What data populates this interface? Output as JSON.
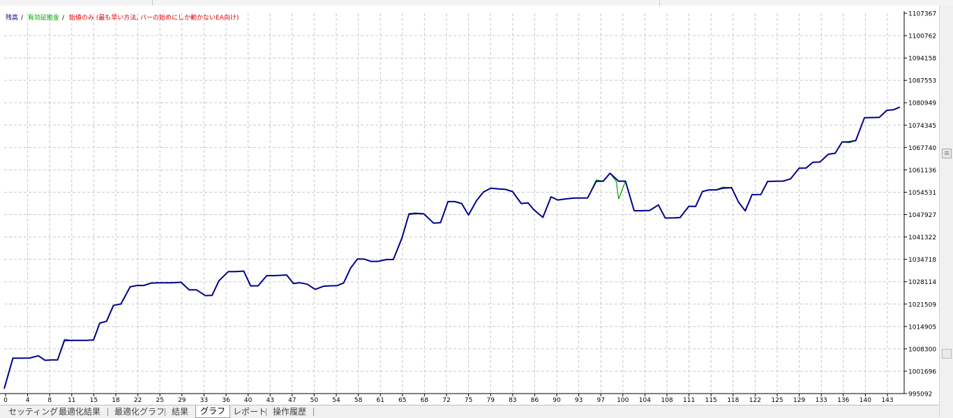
{
  "colors": {
    "balance": "#00008b",
    "equity": "#00a000",
    "note": "#e00000",
    "grid": "#c8c8c8",
    "axis": "#808080"
  },
  "legend": {
    "balance_label": "残高",
    "separator": "/",
    "equity_label": "有効証拠金",
    "note": "始値のみ (最も早い方法, バーの始めにしか動かないEA向け)"
  },
  "tabs": [
    {
      "label": "セッティング"
    },
    {
      "label": "最適化結果"
    },
    {
      "label": "最適化グラフ"
    },
    {
      "label": "結果"
    },
    {
      "label": "グラフ"
    },
    {
      "label": "レポート"
    },
    {
      "label": "操作履歴"
    }
  ],
  "active_tab": "グラフ",
  "chart_data": {
    "type": "line",
    "xlabel": "",
    "ylabel": "",
    "grid": true,
    "legend_position": "top-left",
    "xlim": [
      0,
      145
    ],
    "ylim": [
      995092,
      1107367
    ],
    "x_ticks": [
      "0",
      "4",
      "8",
      "11",
      "15",
      "18",
      "22",
      "25",
      "29",
      "33",
      "36",
      "40",
      "43",
      "47",
      "50",
      "54",
      "58",
      "61",
      "65",
      "68",
      "72",
      "75",
      "79",
      "83",
      "86",
      "90",
      "93",
      "97",
      "100",
      "104",
      "108",
      "111",
      "115",
      "118",
      "122",
      "125",
      "129",
      "133",
      "136",
      "140",
      "143"
    ],
    "y_ticks": [
      "1107367",
      "1100762",
      "1094158",
      "1087553",
      "1080949",
      "1074345",
      "1067740",
      "1061136",
      "1054531",
      "1047927",
      "1041322",
      "1034718",
      "1028114",
      "1021509",
      "1014905",
      "1008300",
      "1001696",
      "995092"
    ],
    "series": [
      {
        "name": "残高",
        "color": "#00008b",
        "x": [
          0,
          1.4,
          2.7,
          4.1,
          5.5,
          6.6,
          7.5,
          8.6,
          9.7,
          10.8,
          12.2,
          13.3,
          14.4,
          15.4,
          16.5,
          17.6,
          18.8,
          20.3,
          21.4,
          22.5,
          23.6,
          24.7,
          25.8,
          26.9,
          28.5,
          29.8,
          31,
          32.4,
          33.5,
          34.6,
          36.1,
          37.2,
          38.6,
          39.7,
          40.9,
          42.3,
          43.4,
          44.6,
          45.5,
          46.6,
          47.6,
          48.8,
          50.1,
          51.5,
          52.5,
          53.6,
          54.7,
          55.8,
          56.9,
          58,
          59.1,
          60.2,
          61.6,
          62.7,
          64.1,
          65.2,
          66.3,
          67.6,
          69.2,
          70.3,
          71.5,
          72.6,
          73.7,
          74.8,
          76.1,
          77.2,
          78.4,
          79.7,
          80.8,
          81.9,
          83.3,
          84.4,
          85.3,
          86.8,
          88.1,
          89.2,
          90.3,
          91.7,
          92.8,
          94,
          95.4,
          96.5,
          97.6,
          99,
          100.1,
          101.5,
          102.6,
          104,
          105.4,
          106.5,
          107.6,
          108.9,
          110.3,
          111.4,
          112.5,
          113.6,
          114.7,
          115.8,
          117.2,
          118.3,
          119.4,
          120.5,
          121.9,
          123,
          124.1,
          125.5,
          126.7,
          128.1,
          129.2,
          130.3,
          131.4,
          132.8,
          133.9,
          135,
          136.1,
          137.2,
          138.6,
          139.7,
          141,
          142.2,
          143.3,
          144.3
        ],
        "y": [
          996530,
          1005540,
          1005540,
          1005580,
          1006250,
          1004890,
          1005020,
          1005020,
          1010720,
          1010790,
          1010790,
          1010790,
          1010940,
          1015890,
          1016450,
          1021110,
          1021540,
          1026620,
          1027010,
          1027010,
          1027680,
          1027800,
          1027800,
          1027800,
          1027960,
          1025700,
          1025700,
          1024020,
          1024080,
          1028400,
          1031090,
          1031090,
          1031250,
          1026890,
          1026900,
          1029910,
          1029910,
          1030020,
          1030110,
          1027600,
          1027810,
          1027390,
          1025840,
          1026800,
          1026890,
          1026940,
          1027760,
          1032090,
          1034790,
          1034780,
          1034110,
          1034110,
          1034670,
          1034670,
          1041110,
          1048030,
          1048240,
          1048150,
          1045390,
          1045540,
          1051760,
          1051760,
          1051210,
          1047800,
          1052030,
          1054570,
          1055740,
          1055490,
          1055360,
          1054730,
          1051210,
          1051400,
          1049420,
          1047100,
          1053170,
          1052230,
          1052510,
          1052800,
          1052810,
          1052850,
          1057780,
          1057790,
          1060130,
          1057790,
          1057800,
          1049070,
          1049070,
          1049140,
          1050780,
          1046920,
          1046920,
          1047040,
          1050340,
          1050340,
          1054780,
          1055220,
          1055230,
          1055720,
          1055880,
          1051640,
          1049020,
          1053820,
          1053840,
          1057710,
          1057770,
          1057830,
          1058490,
          1061660,
          1061680,
          1063380,
          1063440,
          1065760,
          1066050,
          1069350,
          1069430,
          1069780,
          1076520,
          1076570,
          1076630,
          1078710,
          1078900,
          1079670
        ]
      },
      {
        "name": "有効証拠金",
        "color": "#00a000",
        "x": [
          0,
          1.4,
          2.7,
          4.1,
          5.5,
          6.6,
          7.5,
          8.6,
          9.7,
          10.8,
          12.2,
          13.3,
          14.4,
          15.4,
          16.5,
          17.6,
          18.8,
          20.3,
          21.4,
          22.5,
          23.6,
          24.7,
          25.8,
          26.9,
          28.5,
          29.8,
          31,
          32.4,
          33.5,
          34.6,
          36.1,
          37.2,
          38.6,
          39.7,
          40.9,
          42.3,
          43.4,
          44.6,
          45.5,
          46.6,
          47.6,
          48.8,
          50.1,
          51.5,
          52.5,
          53.6,
          54.7,
          55.8,
          56.9,
          58,
          59.1,
          60.2,
          61.6,
          62.7,
          64.1,
          65.2,
          66.3,
          67.6,
          69.2,
          70.3,
          71.5,
          72.6,
          73.7,
          74.8,
          76.1,
          77.2,
          78.4,
          79.7,
          80.8,
          81.9,
          83.3,
          84.4,
          85.3,
          86.8,
          88.1,
          89.2,
          90.3,
          91.7,
          92.8,
          94,
          95.4,
          96.5,
          97.6,
          98.6,
          99,
          100.1,
          101.5,
          102.6,
          104,
          105.4,
          106.5,
          107.6,
          108.9,
          110.3,
          111.4,
          112.5,
          113.6,
          114.7,
          115.8,
          117.2,
          118.3,
          119.4,
          120.5,
          121.9,
          123,
          124.1,
          125.5,
          126.7,
          128.1,
          129.2,
          130.3,
          131.4,
          132.8,
          133.9,
          135,
          136.1,
          137.2,
          138.6,
          139.7,
          141,
          142.2,
          143.3,
          144.3
        ],
        "y": [
          996530,
          1005540,
          1005540,
          1005580,
          1006250,
          1004890,
          1005020,
          1005020,
          1011190,
          1010790,
          1010790,
          1010790,
          1010940,
          1015890,
          1016450,
          1021110,
          1021540,
          1026620,
          1027010,
          1027010,
          1027680,
          1027800,
          1027800,
          1027800,
          1027960,
          1025700,
          1025700,
          1024020,
          1024080,
          1028400,
          1031090,
          1031090,
          1031250,
          1026890,
          1026900,
          1029910,
          1029910,
          1030020,
          1030110,
          1027600,
          1027810,
          1027390,
          1025840,
          1026800,
          1026890,
          1026940,
          1027760,
          1032090,
          1034790,
          1034780,
          1034110,
          1034110,
          1034670,
          1034670,
          1041110,
          1048240,
          1048450,
          1048150,
          1045390,
          1045540,
          1051760,
          1051760,
          1051210,
          1047800,
          1052030,
          1054570,
          1055740,
          1055490,
          1055360,
          1054730,
          1051210,
          1051400,
          1049420,
          1047100,
          1053170,
          1052230,
          1052510,
          1052810,
          1052810,
          1052850,
          1058150,
          1057790,
          1060130,
          1057790,
          1052530,
          1057800,
          1049070,
          1049070,
          1049140,
          1050780,
          1046920,
          1046920,
          1047040,
          1050340,
          1050450,
          1054780,
          1055220,
          1055230,
          1056040,
          1055880,
          1051640,
          1049020,
          1053820,
          1053840,
          1057710,
          1057770,
          1057830,
          1058490,
          1061660,
          1061680,
          1063380,
          1063440,
          1065760,
          1066050,
          1069350,
          1069160,
          1069780,
          1076520,
          1076570,
          1076630,
          1078710,
          1078900,
          1079670
        ]
      }
    ]
  }
}
